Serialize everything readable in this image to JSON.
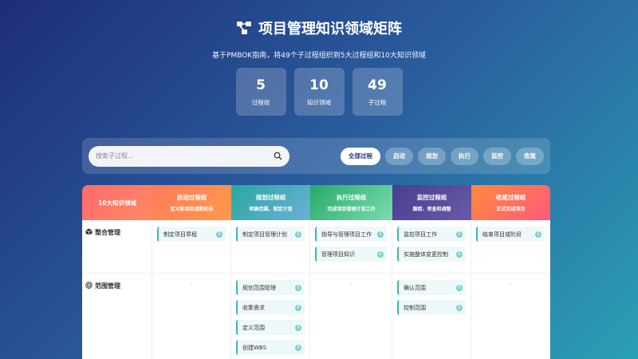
{
  "header": {
    "title": "项目管理知识领域矩阵",
    "subtitle": "基于PMBOK指南，将49个子过程组织到5大过程组和10大知识领域"
  },
  "stats": [
    {
      "value": "5",
      "label": "过程组"
    },
    {
      "value": "10",
      "label": "知识领域"
    },
    {
      "value": "49",
      "label": "子过程"
    }
  ],
  "search": {
    "placeholder": "搜索子过程..."
  },
  "filters": [
    "全部过程",
    "启动",
    "规划",
    "执行",
    "监控",
    "收尾"
  ],
  "matrix": {
    "headers": [
      {
        "title": "10大知识领域",
        "sub": ""
      },
      {
        "title": "启动过程组",
        "sub": "定义新项目或新阶段"
      },
      {
        "title": "规划过程组",
        "sub": "明确范围，制定计划"
      },
      {
        "title": "执行过程组",
        "sub": "完成项目管理计划工作"
      },
      {
        "title": "监控过程组",
        "sub": "跟踪、审查和调整"
      },
      {
        "title": "收尾过程组",
        "sub": "正式完成项目"
      }
    ],
    "rows": [
      {
        "icon": "cube-icon",
        "area": "整合管理",
        "cells": [
          [
            "制定项目章程"
          ],
          [
            "制定项目管理计划"
          ],
          [
            "指导与管理项目工作",
            "管理项目知识"
          ],
          [
            "监控项目工作",
            "实施整体变更控制"
          ],
          [
            "结束项目或阶段"
          ]
        ]
      },
      {
        "icon": "target-icon",
        "area": "范围管理",
        "cells": [
          [],
          [
            "规划范围管理",
            "收集需求",
            "定义范围",
            "创建WBS"
          ],
          [],
          [
            "确认范围",
            "控制范围"
          ],
          []
        ]
      }
    ],
    "empty_mark": "-",
    "info_glyph": "i"
  },
  "colors": {
    "bg_start": "#1e2d7a",
    "bg_end": "#2aa0b4",
    "process_border": "#3bb8b0"
  }
}
